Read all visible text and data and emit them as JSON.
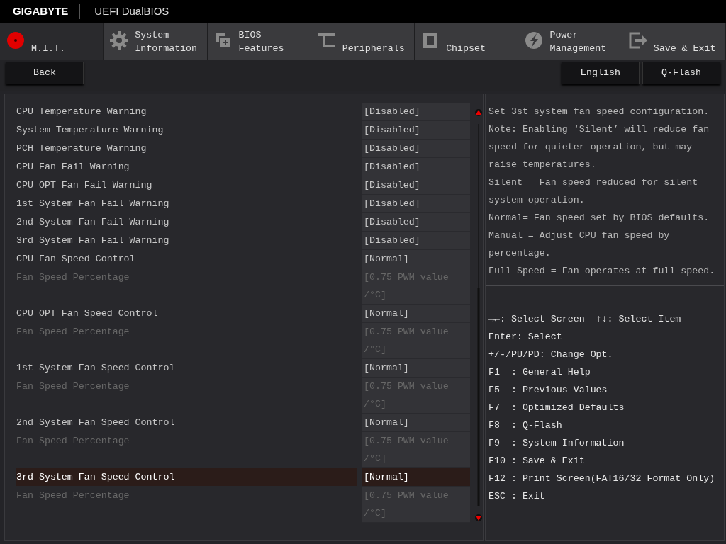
{
  "header": {
    "brand": "GIGABYTE",
    "title": "UEFI DualBIOS"
  },
  "tabs": [
    {
      "label": [
        "M.I.T."
      ],
      "selected": true
    },
    {
      "label": [
        "System",
        "Information"
      ],
      "selected": false
    },
    {
      "label": [
        "BIOS",
        "Features"
      ],
      "selected": false
    },
    {
      "label": [
        "Peripherals"
      ],
      "selected": false
    },
    {
      "label": [
        "Chipset"
      ],
      "selected": false
    },
    {
      "label": [
        "Power",
        "Management"
      ],
      "selected": false
    },
    {
      "label": [
        "Save & Exit"
      ],
      "selected": false
    }
  ],
  "buttons": {
    "left": [
      "Back"
    ],
    "right": [
      "English",
      "Q-Flash"
    ]
  },
  "settings": [
    {
      "name": "CPU Temperature Warning",
      "value": "[Disabled]",
      "disabled": false,
      "selected": false
    },
    {
      "name": "System Temperature Warning",
      "value": "[Disabled]",
      "disabled": false,
      "selected": false
    },
    {
      "name": "PCH Temperature Warning",
      "value": "[Disabled]",
      "disabled": false,
      "selected": false
    },
    {
      "name": "CPU Fan Fail Warning",
      "value": "[Disabled]",
      "disabled": false,
      "selected": false
    },
    {
      "name": "CPU OPT Fan Fail Warning",
      "value": "[Disabled]",
      "disabled": false,
      "selected": false
    },
    {
      "name": "1st System Fan Fail Warning",
      "value": "[Disabled]",
      "disabled": false,
      "selected": false
    },
    {
      "name": "2nd System Fan Fail Warning",
      "value": "[Disabled]",
      "disabled": false,
      "selected": false
    },
    {
      "name": "3rd System Fan Fail Warning",
      "value": "[Disabled]",
      "disabled": false,
      "selected": false
    },
    {
      "name": "CPU Fan Speed Control",
      "value": "[Normal]",
      "disabled": false,
      "selected": false
    },
    {
      "name": "Fan Speed Percentage",
      "value": "[0.75 PWM value /°C]",
      "disabled": true,
      "selected": false
    },
    {
      "name": "CPU OPT Fan Speed Control",
      "value": "[Normal]",
      "disabled": false,
      "selected": false
    },
    {
      "name": "Fan Speed Percentage",
      "value": "[0.75 PWM value /°C]",
      "disabled": true,
      "selected": false
    },
    {
      "name": "1st System Fan Speed Control",
      "value": "[Normal]",
      "disabled": false,
      "selected": false
    },
    {
      "name": "Fan Speed Percentage",
      "value": "[0.75 PWM value /°C]",
      "disabled": true,
      "selected": false
    },
    {
      "name": "2nd System Fan Speed Control",
      "value": "[Normal]",
      "disabled": false,
      "selected": false
    },
    {
      "name": "Fan Speed Percentage",
      "value": "[0.75 PWM value /°C]",
      "disabled": true,
      "selected": false
    },
    {
      "name": "3rd System Fan Speed Control",
      "value": "[Normal]",
      "disabled": false,
      "selected": true
    },
    {
      "name": "Fan Speed Percentage",
      "value": "[0.75 PWM value /°C]",
      "disabled": true,
      "selected": false
    }
  ],
  "help": [
    "Set 3st system fan speed configuration.",
    "Note: Enabling ‘Silent’ will reduce fan speed for quieter operation, but may raise temperatures.",
    "Silent = Fan speed reduced for silent system operation.",
    "Normal= Fan speed set by BIOS defaults.",
    "Manual = Adjust CPU fan speed by percentage.",
    "Full Speed = Fan operates at full speed."
  ],
  "key_help": [
    [
      "→←: Select Screen",
      "↑↓: Select Item"
    ],
    [
      "Enter: Select"
    ],
    [
      "+/-/PU/PD: Change Opt."
    ],
    [
      "F1  : General Help"
    ],
    [
      "F5  : Previous Values"
    ],
    [
      "F7  : Optimized Defaults"
    ],
    [
      "F8  : Q-Flash"
    ],
    [
      "F9  : System Information"
    ],
    [
      "F10 : Save & Exit"
    ],
    [
      "F12 : Print Screen(FAT16/32 Format Only)"
    ],
    [
      "ESC : Exit"
    ]
  ]
}
